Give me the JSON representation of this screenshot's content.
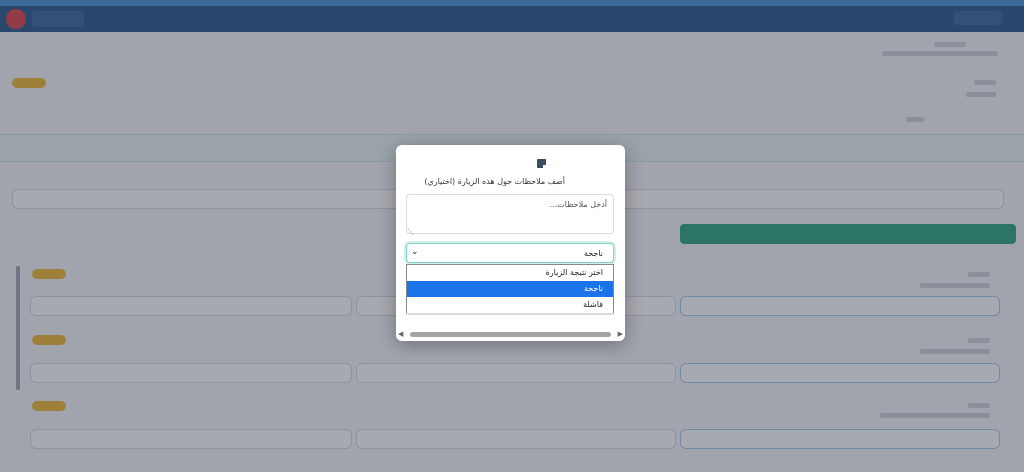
{
  "modal": {
    "label": "أضف ملاحظات حول هذه الزيارة (اختياري)",
    "notes_placeholder": "أدخل ملاحظات...",
    "notes_value": "",
    "select_value": "ناجحة",
    "options": [
      {
        "label": "اختر نتيجة الزيارة",
        "selected": false
      },
      {
        "label": "ناجحة",
        "selected": true
      },
      {
        "label": "فاشلة",
        "selected": false
      }
    ]
  },
  "icons": {
    "note": "note-icon",
    "chevron": "chevron-down-icon",
    "resize": "resize-handle-icon",
    "scroll_left": "scroll-left-icon",
    "scroll_right": "scroll-right-icon"
  },
  "colors": {
    "navbar": "#1f4e86",
    "accent_bar": "#3b8bd6",
    "select_focus": "#7fd0c2",
    "option_selected": "#1a73e8",
    "success_button": "#1f9e75",
    "badge": "#f0b429"
  }
}
